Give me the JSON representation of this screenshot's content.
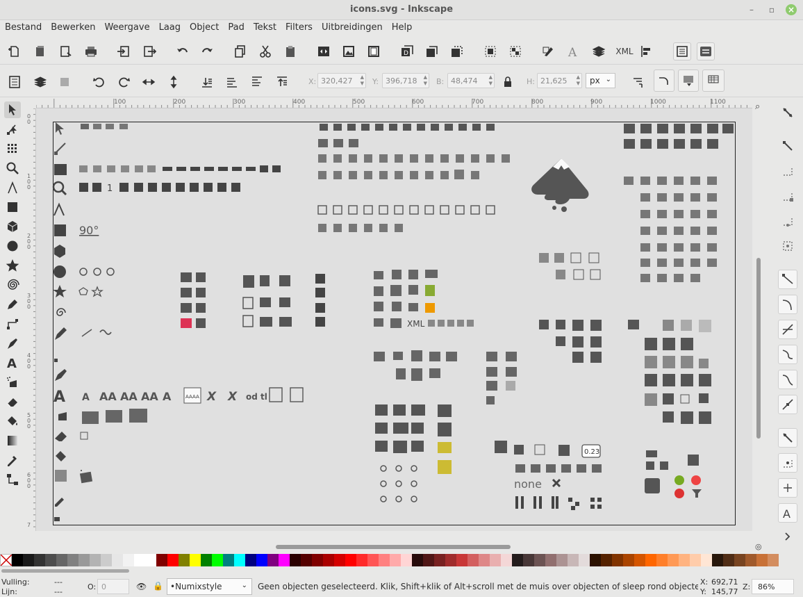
{
  "window": {
    "title": "icons.svg - Inkscape",
    "minimize_icon": "minimize-icon",
    "maximize_icon": "maximize-icon",
    "close_icon": "close-icon"
  },
  "menubar": [
    "Bestand",
    "Bewerken",
    "Weergave",
    "Laag",
    "Object",
    "Pad",
    "Tekst",
    "Filters",
    "Uitbreidingen",
    "Help"
  ],
  "commandbar": {
    "xml_label": "XML"
  },
  "controls": {
    "x_label": "X:",
    "x_value": "320,427",
    "y_label": "Y:",
    "y_value": "396,718",
    "w_label": "B:",
    "w_value": "48,474",
    "h_label": "H:",
    "h_value": "21,625",
    "unit": "px"
  },
  "ruler_top": [
    "100",
    "200",
    "300",
    "400",
    "500",
    "600",
    "700",
    "800",
    "900",
    "1000",
    "1100"
  ],
  "ruler_left": [
    "0",
    "0",
    "1",
    "0",
    "0",
    "2",
    "0",
    "0",
    "3",
    "0",
    "0",
    "4",
    "0",
    "0",
    "5",
    "0",
    "0",
    "6",
    "0",
    "0",
    "7"
  ],
  "canvas_text": {
    "degrees": "90°",
    "xml": "XML",
    "none": "none",
    "counter": "0.23",
    "one": "1",
    "aaaa": "AAAA"
  },
  "statusbar": {
    "fill_label": "Vulling:",
    "fill_value": "---",
    "stroke_label": "Lijn:",
    "stroke_value": "---",
    "opacity_label": "O:",
    "opacity_value": "0",
    "layer": "•Numixstyle",
    "message": "Geen objecten geselecteerd. Klik, Shift+klik of Alt+scroll met de muis over objecten of sleep rond objecten om te se",
    "x_label": "X:",
    "x_value": "692,71",
    "y_label": "Y:",
    "y_value": "145,77",
    "zoom_label": "Z:",
    "zoom_value": "86%"
  },
  "palette": [
    "#000000",
    "#1a1a1a",
    "#333333",
    "#4d4d4d",
    "#666666",
    "#808080",
    "#999999",
    "#b3b3b3",
    "#cccccc",
    "#e6e6e6",
    "#f2f2f2",
    "#ffffff",
    "#ffffff",
    "#800000",
    "#ff0000",
    "#808000",
    "#ffff00",
    "#008000",
    "#00ff00",
    "#008080",
    "#00ffff",
    "#000080",
    "#0000ff",
    "#800080",
    "#ff00ff",
    "#2b0000",
    "#550000",
    "#800000",
    "#aa0000",
    "#d40000",
    "#ff0000",
    "#ff2a2a",
    "#ff5555",
    "#ff8080",
    "#ffaaaa",
    "#ffd5d5",
    "#280b0b",
    "#501616",
    "#782121",
    "#a02c2c",
    "#c83737",
    "#d35f5f",
    "#de8787",
    "#e9afaf",
    "#f4d7d7",
    "#241c1c",
    "#483737",
    "#6c5353",
    "#916f6f",
    "#ac9393",
    "#c8b7b7",
    "#e3dbdb",
    "#2b1100",
    "#552200",
    "#803300",
    "#aa4400",
    "#d45500",
    "#ff6600",
    "#ff7f2a",
    "#ff9955",
    "#ffb380",
    "#ffccaa",
    "#ffe6d5",
    "#28170b",
    "#502d16",
    "#784421",
    "#a05a2c",
    "#c87137",
    "#d38d5f"
  ]
}
